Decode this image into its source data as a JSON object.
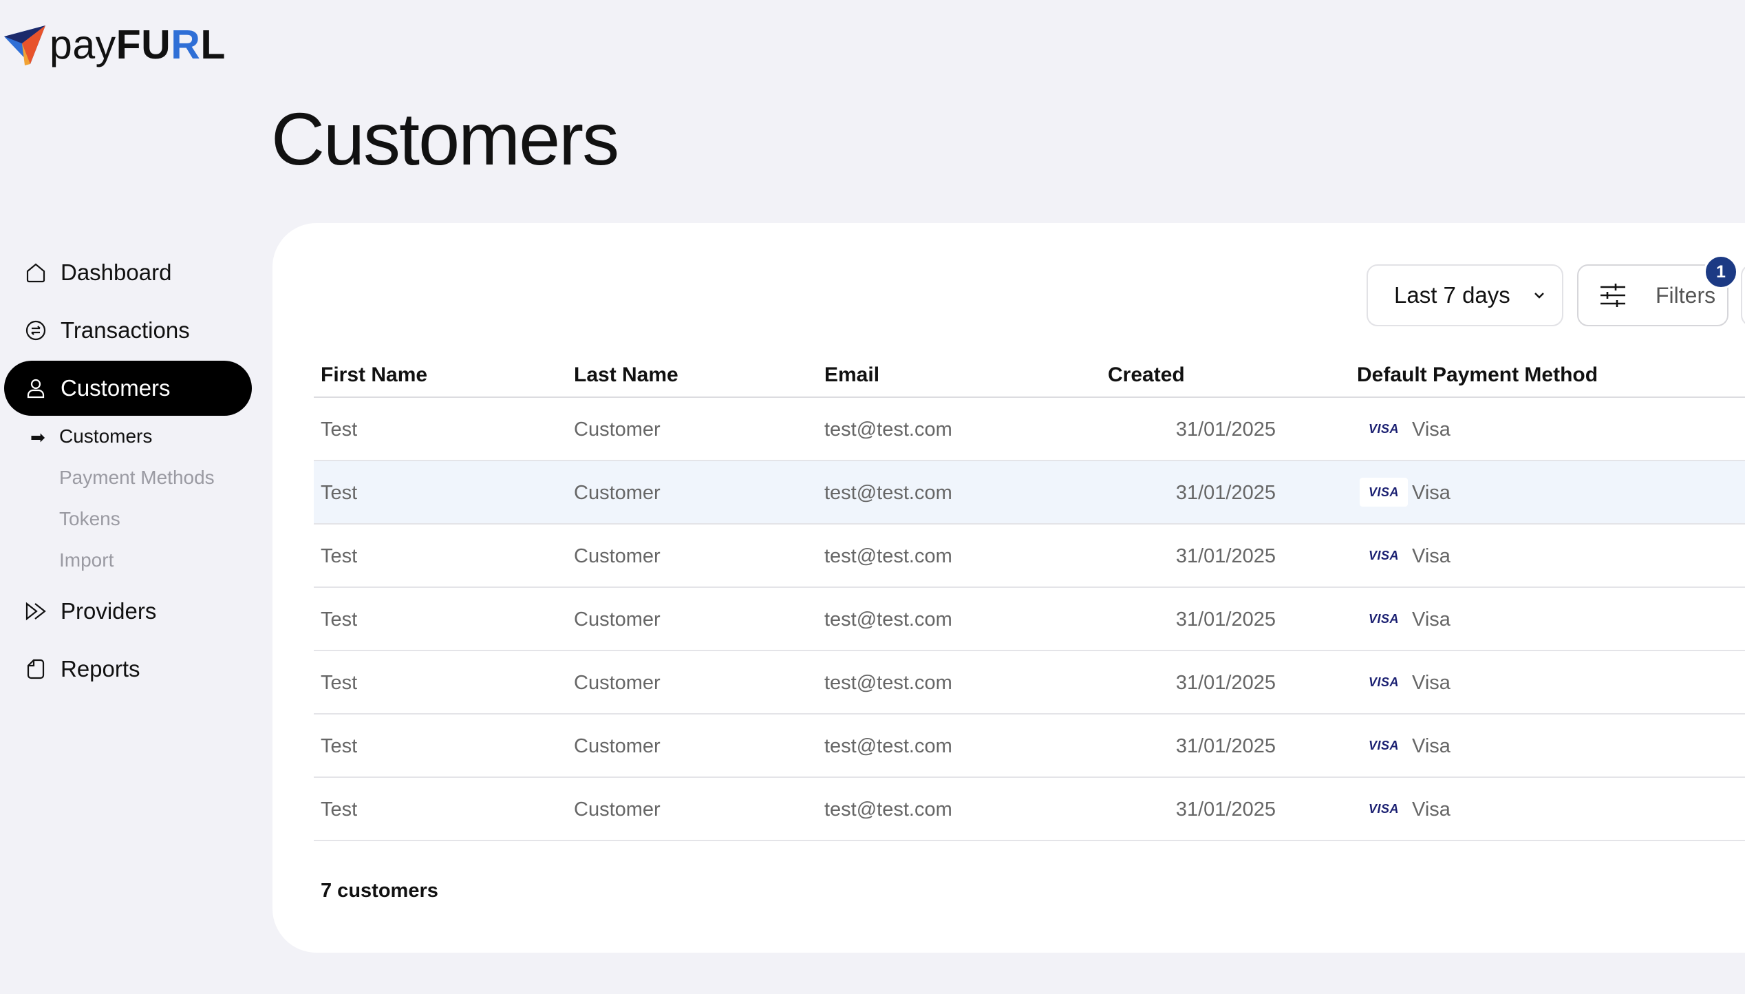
{
  "app": {
    "logo_text_pay": "pay",
    "logo_text_fu": "FU",
    "logo_text_r": "R",
    "logo_text_l": "L",
    "accent_color": "#2f6fd6"
  },
  "page_title": "Customers",
  "sidebar": {
    "items": [
      {
        "label": "Dashboard",
        "icon": "home-icon"
      },
      {
        "label": "Transactions",
        "icon": "exchange-icon"
      },
      {
        "label": "Customers",
        "icon": "user-icon",
        "active": true
      },
      {
        "label": "Providers",
        "icon": "forward-icon"
      },
      {
        "label": "Reports",
        "icon": "document-icon"
      }
    ],
    "sub_items": [
      {
        "label": "Customers",
        "active": true
      },
      {
        "label": "Payment Methods"
      },
      {
        "label": "Tokens"
      },
      {
        "label": "Import"
      }
    ],
    "sub_arrow": "➡"
  },
  "toolbar": {
    "date_range": "Last 7 days",
    "filters_label": "Filters",
    "filters_badge": "1"
  },
  "table": {
    "headers": {
      "first_name": "First Name",
      "last_name": "Last Name",
      "email": "Email",
      "created": "Created",
      "default_payment_method": "Default Payment Method"
    },
    "rows": [
      {
        "first": "Test",
        "last": "Customer",
        "email": "test@test.com",
        "created": "31/01/2025",
        "pm_logo": "VISA",
        "pm": "Visa"
      },
      {
        "first": "Test",
        "last": "Customer",
        "email": "test@test.com",
        "created": "31/01/2025",
        "pm_logo": "VISA",
        "pm": "Visa"
      },
      {
        "first": "Test",
        "last": "Customer",
        "email": "test@test.com",
        "created": "31/01/2025",
        "pm_logo": "VISA",
        "pm": "Visa"
      },
      {
        "first": "Test",
        "last": "Customer",
        "email": "test@test.com",
        "created": "31/01/2025",
        "pm_logo": "VISA",
        "pm": "Visa"
      },
      {
        "first": "Test",
        "last": "Customer",
        "email": "test@test.com",
        "created": "31/01/2025",
        "pm_logo": "VISA",
        "pm": "Visa"
      },
      {
        "first": "Test",
        "last": "Customer",
        "email": "test@test.com",
        "created": "31/01/2025",
        "pm_logo": "VISA",
        "pm": "Visa"
      },
      {
        "first": "Test",
        "last": "Customer",
        "email": "test@test.com",
        "created": "31/01/2025",
        "pm_logo": "VISA",
        "pm": "Visa"
      }
    ],
    "footer_count": "7 customers"
  }
}
